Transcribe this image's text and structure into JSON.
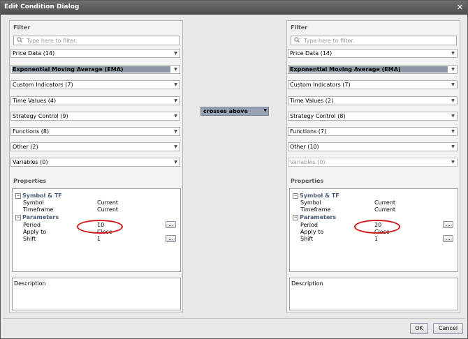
{
  "window": {
    "title": "Edit Condition Dialog",
    "close_glyph": "✕"
  },
  "left": {
    "filter_title": "Filter",
    "filter_placeholder": "Type here to filter.",
    "dropdowns": [
      {
        "label": "Price Data (14)"
      },
      {
        "label": "Exponential Moving Average (EMA)",
        "selected": true
      },
      {
        "label": "Custom Indicators (7)"
      },
      {
        "label": "Time Values (4)"
      },
      {
        "label": "Strategy Control (9)"
      },
      {
        "label": "Functions (8)"
      },
      {
        "label": "Other (2)"
      },
      {
        "label": "Variables (0)"
      }
    ],
    "properties_title": "Properties",
    "groups": [
      {
        "name": "Symbol & TF",
        "rows": [
          {
            "name": "Symbol",
            "value": "Current"
          },
          {
            "name": "Timeframe",
            "value": "Current"
          }
        ]
      },
      {
        "name": "Parameters",
        "rows": [
          {
            "name": "Period",
            "value": "10"
          },
          {
            "name": "Apply to",
            "value": "Close"
          },
          {
            "name": "Shift",
            "value": "1"
          }
        ]
      }
    ],
    "description_label": "Description"
  },
  "right": {
    "filter_title": "Filter",
    "filter_placeholder": "Type here to filter.",
    "dropdowns": [
      {
        "label": "Price Data (14)"
      },
      {
        "label": "Exponential Moving Average (EMA)",
        "selected": true
      },
      {
        "label": "Custom Indicators (7)"
      },
      {
        "label": "Time Values (2)"
      },
      {
        "label": "Strategy Control (8)"
      },
      {
        "label": "Functions (7)"
      },
      {
        "label": "Other (10)"
      },
      {
        "label": "Variables (0)",
        "disabled": true
      }
    ],
    "properties_title": "Properties",
    "groups": [
      {
        "name": "Symbol & TF",
        "rows": [
          {
            "name": "Symbol",
            "value": "Current"
          },
          {
            "name": "Timeframe",
            "value": "Current"
          }
        ]
      },
      {
        "name": "Parameters",
        "rows": [
          {
            "name": "Period",
            "value": "20"
          },
          {
            "name": "Apply to",
            "value": "Close"
          },
          {
            "name": "Shift",
            "value": "1"
          }
        ]
      }
    ],
    "description_label": "Description"
  },
  "operator": {
    "label": "crosses above"
  },
  "buttons": {
    "ok": "OK",
    "cancel": "Cancel",
    "ellipsis": "..."
  },
  "icons": {
    "magnifier": "search-icon",
    "dropdown_arrow": "chevron-down-icon",
    "collapse": "minus-box-icon"
  },
  "colors": {
    "highlight": "#8d97a6",
    "annotation": "#d11b1b",
    "group_text": "#4a5a77"
  }
}
